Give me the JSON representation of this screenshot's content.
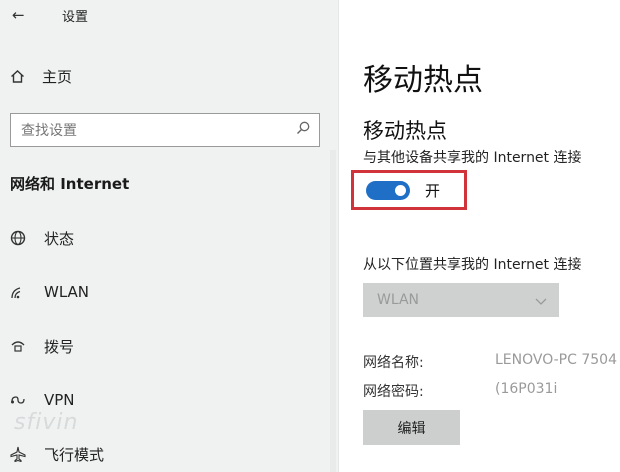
{
  "window": {
    "back_symbol": "←",
    "title": "设置"
  },
  "sidebar": {
    "home_label": "主页",
    "search_placeholder": "查找设置",
    "section_title": "网络和 Internet",
    "items": [
      {
        "label": "状态",
        "icon": "globe-icon"
      },
      {
        "label": "WLAN",
        "icon": "wifi-icon"
      },
      {
        "label": "拨号",
        "icon": "dialup-icon"
      },
      {
        "label": "VPN",
        "icon": "vpn-icon"
      },
      {
        "label": "飞行模式",
        "icon": "airplane-icon"
      }
    ],
    "watermark": "sfivin"
  },
  "main": {
    "page_title": "移动热点",
    "hotspot_title": "移动热点",
    "share_desc": "与其他设备共享我的 Internet 连接",
    "toggle": {
      "state": "on",
      "label": "开",
      "color": "#1f6fc6"
    },
    "highlight_color": "#d0343a",
    "share_from_label": "从以下位置共享我的 Internet 连接",
    "share_from_value": "WLAN",
    "network_name_label": "网络名称:",
    "network_name_value": "LENOVO-PC 7504",
    "network_password_label": "网络密码:",
    "network_password_value": "(16P031i",
    "edit_button": "编辑"
  }
}
